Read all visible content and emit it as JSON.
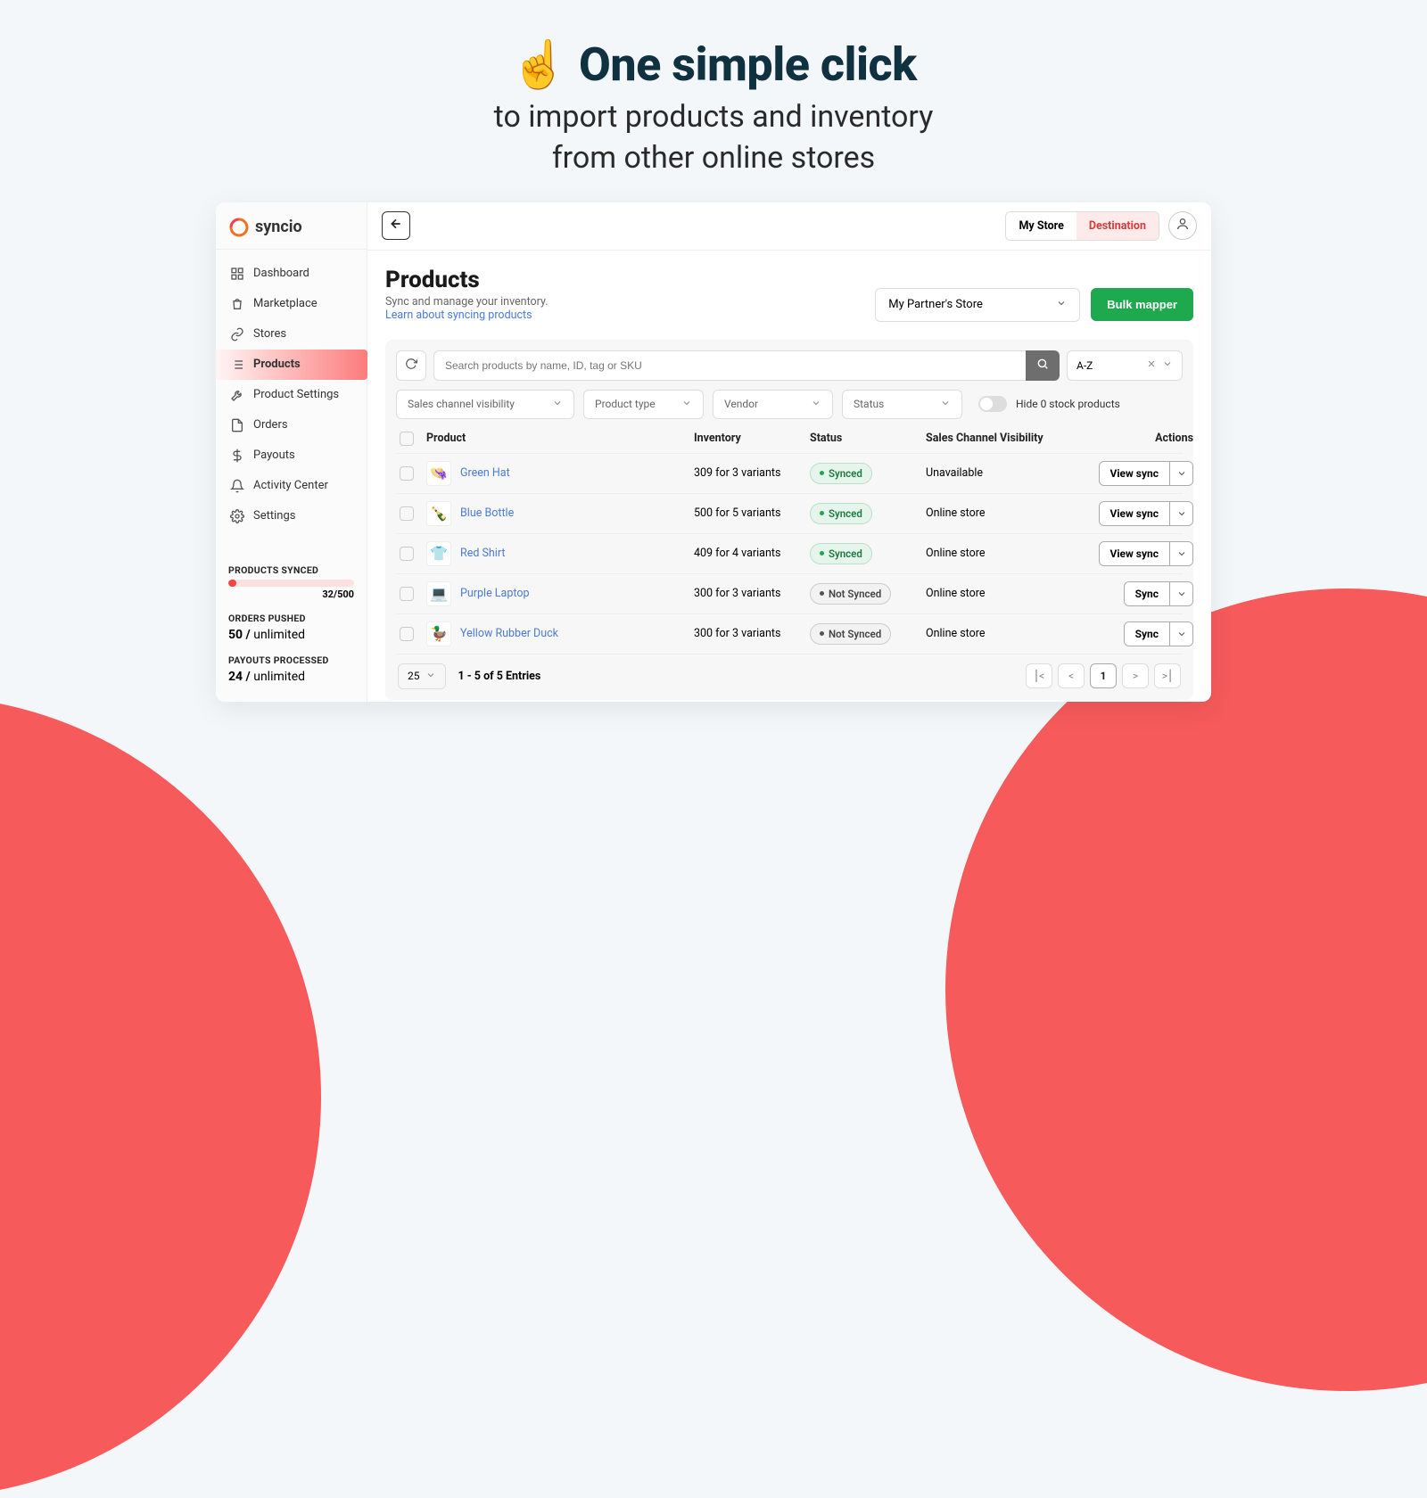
{
  "promo": {
    "emoji": "☝️",
    "headline": "One simple click",
    "sub1": "to import products and inventory",
    "sub2": "from other online stores"
  },
  "brand": {
    "name": "syncio"
  },
  "nav": {
    "dashboard": "Dashboard",
    "marketplace": "Marketplace",
    "stores": "Stores",
    "products": "Products",
    "product_settings": "Product Settings",
    "orders": "Orders",
    "payouts": "Payouts",
    "activity_center": "Activity Center",
    "settings": "Settings"
  },
  "stats": {
    "synced_label": "PRODUCTS SYNCED",
    "synced_text": "32/500",
    "orders_label": "ORDERS PUSHED",
    "orders_value": "50 /",
    "orders_unit": "unlimited",
    "payouts_label": "PAYOUTS PROCESSED",
    "payouts_value": "24 /",
    "payouts_unit": "unlimited"
  },
  "topbar": {
    "mystore": "My Store",
    "destination": "Destination"
  },
  "page": {
    "title": "Products",
    "sub": "Sync and manage your inventory.",
    "link": "Learn about syncing products",
    "store": "My Partner's Store",
    "bulk": "Bulk mapper"
  },
  "filters": {
    "search_placeholder": "Search products by name, ID, tag or SKU",
    "sort": "A-Z",
    "f1": "Sales channel visibility",
    "f2": "Product type",
    "f3": "Vendor",
    "f4": "Status",
    "toggle": "Hide 0 stock products"
  },
  "table": {
    "h_product": "Product",
    "h_inventory": "Inventory",
    "h_status": "Status",
    "h_visibility": "Sales Channel Visibility",
    "h_actions": "Actions",
    "rows": [
      {
        "emoji": "👒",
        "name": "Green Hat",
        "inv": "309 for 3 variants",
        "status": "Synced",
        "synced": true,
        "vis": "Unavailable",
        "action": "View sync"
      },
      {
        "emoji": "🍾",
        "name": "Blue Bottle",
        "inv": "500 for 5 variants",
        "status": "Synced",
        "synced": true,
        "vis": "Online store",
        "action": "View sync"
      },
      {
        "emoji": "👕",
        "name": "Red Shirt",
        "inv": "409 for 4 variants",
        "status": "Synced",
        "synced": true,
        "vis": "Online store",
        "action": "View sync"
      },
      {
        "emoji": "💻",
        "name": "Purple Laptop",
        "inv": "300 for 3 variants",
        "status": "Not Synced",
        "synced": false,
        "vis": "Online store",
        "action": "Sync"
      },
      {
        "emoji": "🦆",
        "name": "Yellow Rubber Duck",
        "inv": "300 for 3 variants",
        "status": "Not Synced",
        "synced": false,
        "vis": "Online store",
        "action": "Sync"
      }
    ],
    "pagesize": "25",
    "entries": "1 - 5 of 5 Entries",
    "page": "1"
  }
}
